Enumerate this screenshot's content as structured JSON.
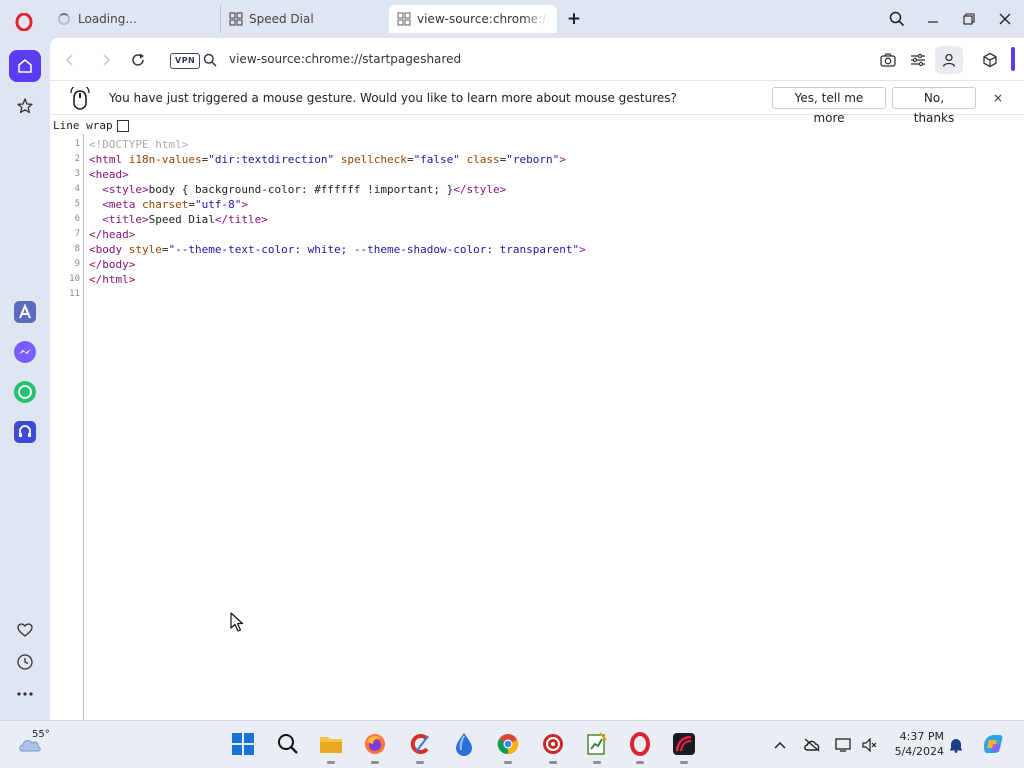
{
  "tabs": [
    {
      "title": "Loading..."
    },
    {
      "title": "Speed Dial"
    },
    {
      "title": "view-source:chrome://startpageshared"
    }
  ],
  "address": {
    "vpn_label": "VPN",
    "url": "view-source:chrome://startpageshared"
  },
  "infobar": {
    "message": "You have just triggered a mouse gesture. Would you like to learn more about mouse gestures?",
    "yes_label": "Yes, tell me more",
    "no_label": "No, thanks",
    "close_label": "×"
  },
  "source": {
    "line_wrap_label": "Line wrap",
    "lines": [
      {
        "n": "1",
        "text": "<!DOCTYPE html>"
      },
      {
        "n": "2",
        "text": "<html i18n-values=\"dir:textdirection\" spellcheck=\"false\" class=\"reborn\">"
      },
      {
        "n": "3",
        "text": "<head>"
      },
      {
        "n": "4",
        "text": "  <style>body { background-color: #ffffff !important; }</style>"
      },
      {
        "n": "5",
        "text": "  <meta charset=\"utf-8\">"
      },
      {
        "n": "6",
        "text": "  <title>Speed Dial</title>"
      },
      {
        "n": "7",
        "text": "</head>"
      },
      {
        "n": "8",
        "text": "<body style=\"--theme-text-color: white; --theme-shadow-color: transparent\">"
      },
      {
        "n": "9",
        "text": "</body>"
      },
      {
        "n": "10",
        "text": "</html>"
      },
      {
        "n": "11",
        "text": ""
      }
    ]
  },
  "taskbar": {
    "temperature": "55°",
    "time": "4:37 PM",
    "date": "5/4/2024"
  },
  "colors": {
    "accent": "#5b3cf2",
    "opera_red": "#e0242e",
    "tag": "#881280",
    "attr": "#994500",
    "value": "#1a1aa6"
  }
}
